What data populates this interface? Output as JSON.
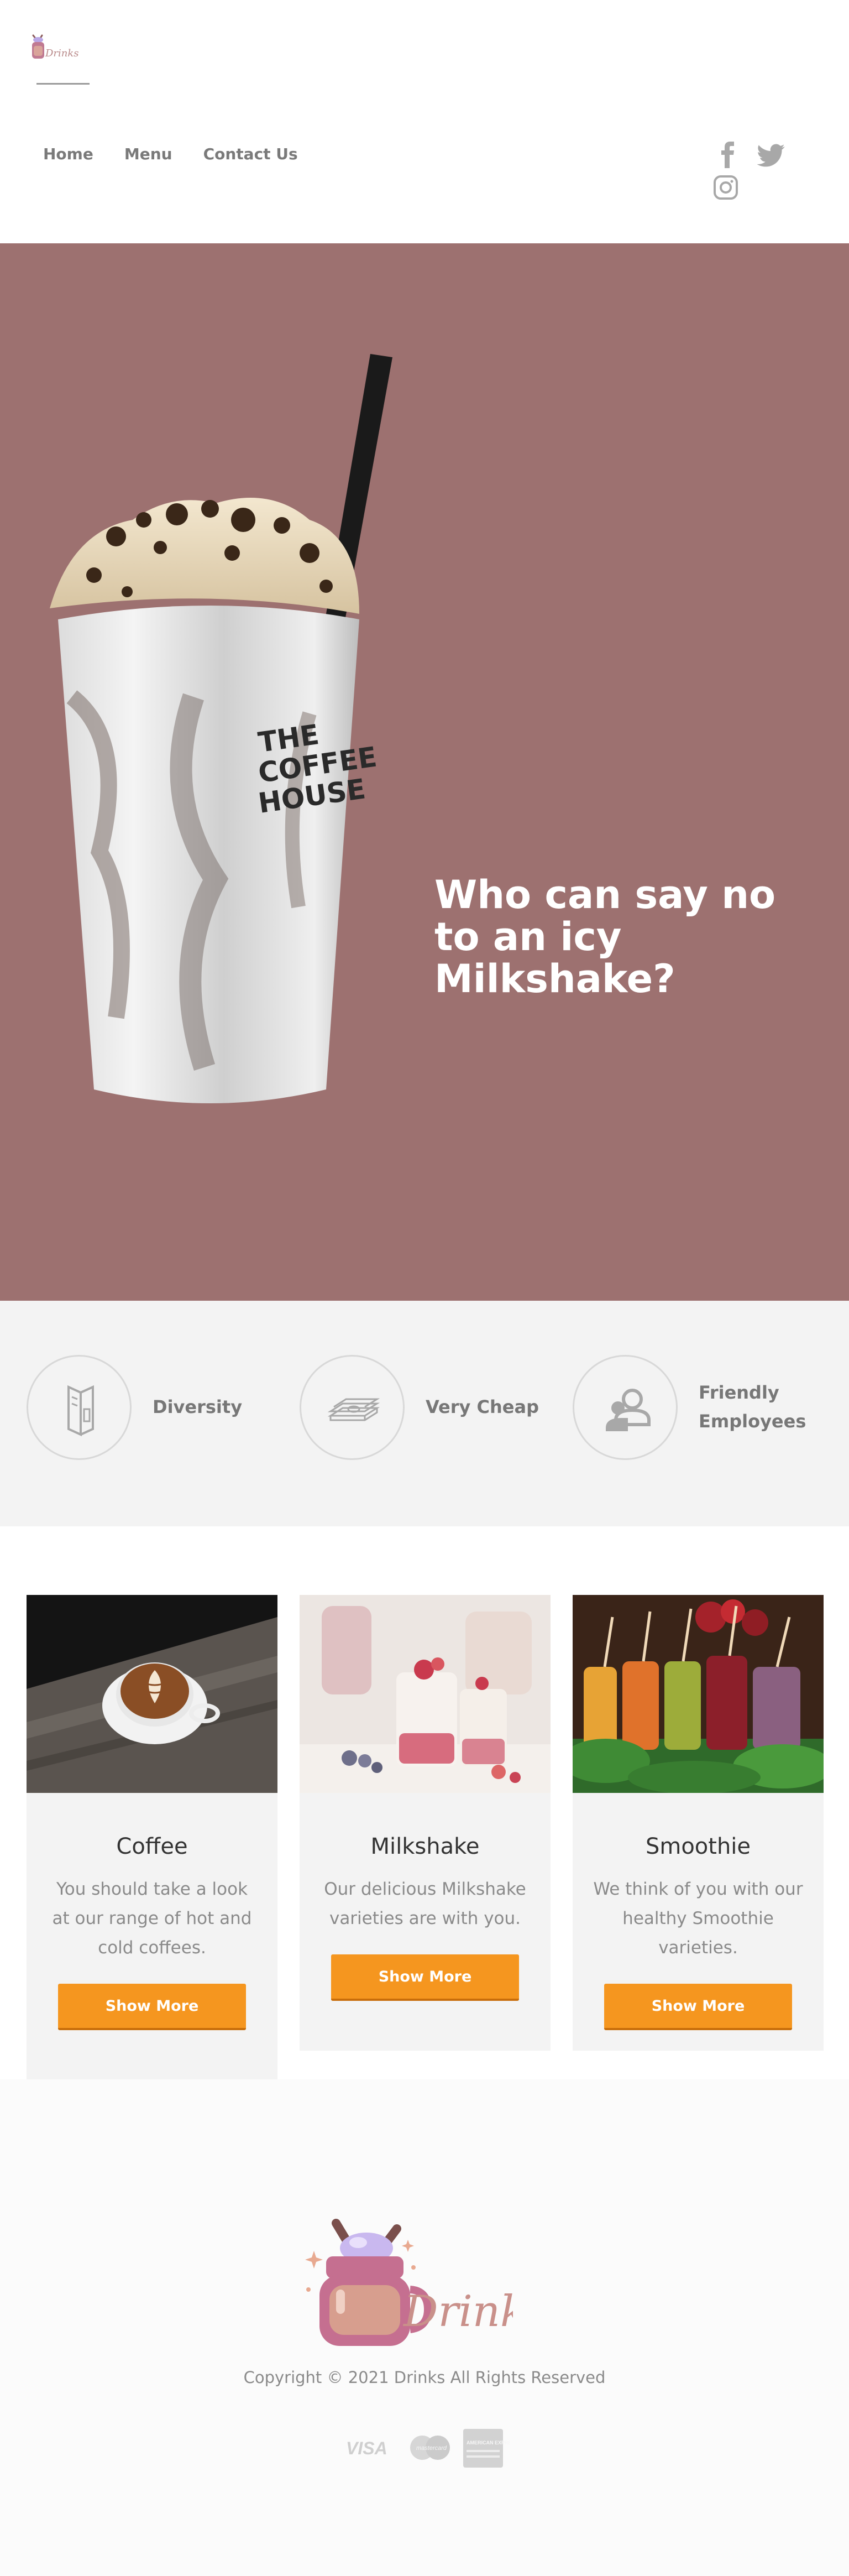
{
  "header": {
    "brand": "Drinks",
    "nav": [
      {
        "label": "Home"
      },
      {
        "label": "Menu"
      },
      {
        "label": "Contact Us"
      }
    ],
    "social": [
      "facebook-icon",
      "twitter-icon",
      "instagram-icon"
    ]
  },
  "hero": {
    "title": "Who can say no to an icy Milkshake?",
    "cup_print": [
      "THE",
      "COFFEE",
      "HOUSE"
    ],
    "background": "#9d7170"
  },
  "features": [
    {
      "label": "Diversity",
      "icon": "menu-book-icon"
    },
    {
      "label": "Very Cheap",
      "icon": "money-stack-icon"
    },
    {
      "label": "Friendly Employees",
      "icon": "employees-icon"
    }
  ],
  "cards": [
    {
      "title": "Coffee",
      "text": "You should take a look at our range of hot and cold coffees.",
      "button": "Show More"
    },
    {
      "title": "Milkshake",
      "text": "Our delicious Milkshake varieties are with you.",
      "button": "Show More"
    },
    {
      "title": "Smoothie",
      "text": "We think of you with our healthy Smoothie varieties.",
      "button": "Show More"
    }
  ],
  "footer": {
    "brand": "Drinks",
    "copyright": "Copyright © 2021 Drinks All Rights Reserved",
    "payments": [
      "VISA",
      "mastercard",
      "AMERICAN EXPRESS"
    ]
  },
  "colors": {
    "accent": "#f5961f",
    "hero_bg": "#9d7170",
    "brand_pink": "#b96e85"
  }
}
